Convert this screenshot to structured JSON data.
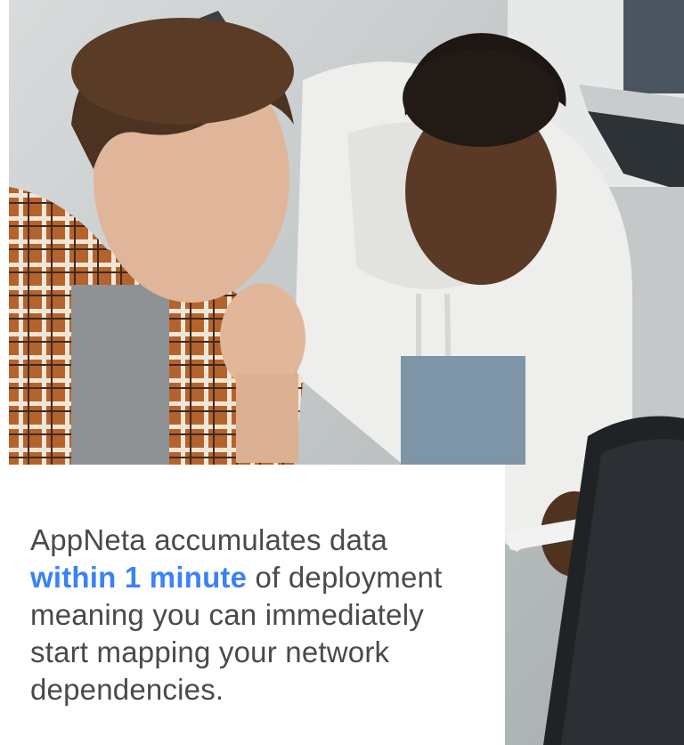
{
  "caption": {
    "intro": "AppNeta accumulates data",
    "highlight": "within 1 minute",
    "rest": "of deployment meaning you can immediately start mapping your network dependencies."
  },
  "colors": {
    "highlight": "#3b82f6",
    "body_text": "#4a4a4a",
    "card_background": "#ffffff"
  }
}
